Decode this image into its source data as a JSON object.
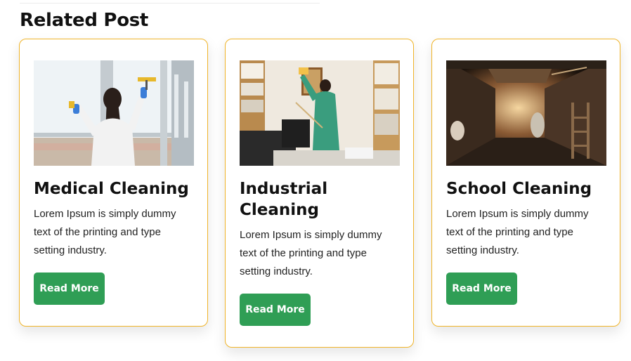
{
  "section": {
    "title": "Related Post"
  },
  "posts": [
    {
      "title": "Medical Cleaning",
      "excerpt": "Lorem Ipsum is simply dummy text of the printing and type setting industry.",
      "button_label": "Read More",
      "image": "woman-cleaning-window-photo"
    },
    {
      "title": "Industrial Cleaning",
      "excerpt": "Lorem Ipsum is simply dummy text of the printing and type setting industry.",
      "button_label": "Read More",
      "image": "cleaner-dusting-office-photo"
    },
    {
      "title": "School Cleaning",
      "excerpt": "Lorem Ipsum is simply dummy text of the printing and type setting industry.",
      "button_label": "Read More",
      "image": "pressure-washing-alley-photo"
    }
  ],
  "colors": {
    "card_border": "#f0b429",
    "button_bg": "#2f9e55",
    "button_text": "#ffffff",
    "heading": "#111111"
  }
}
